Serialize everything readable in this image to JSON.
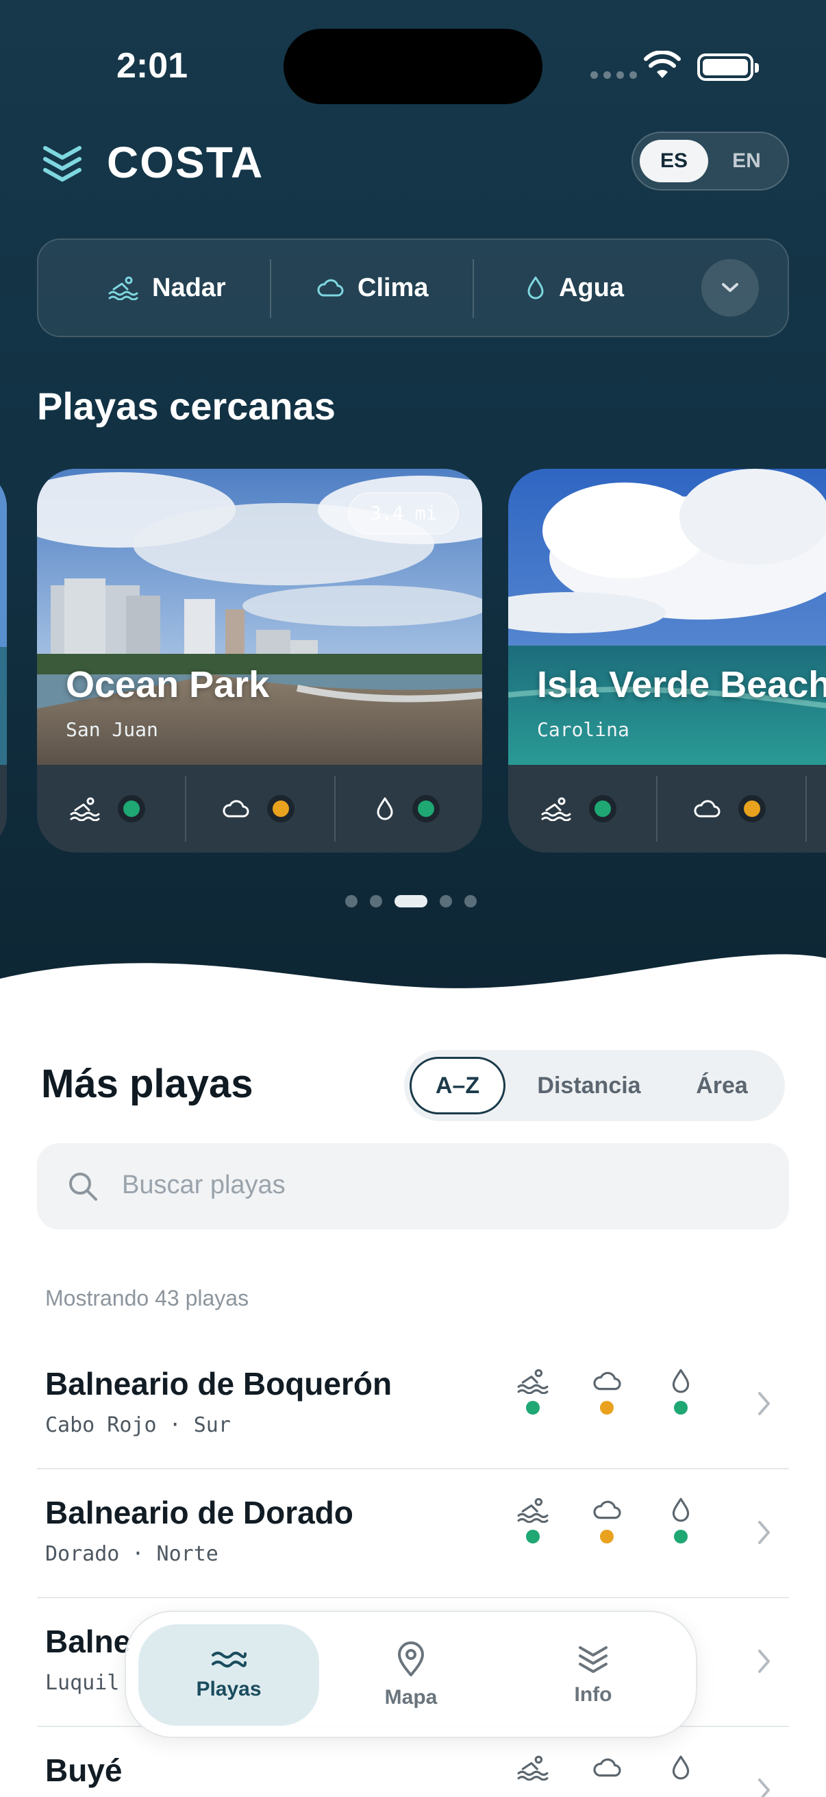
{
  "status_bar": {
    "time": "2:01"
  },
  "header": {
    "brand": "COSTA",
    "lang_es": "ES",
    "lang_en": "EN"
  },
  "filters": [
    {
      "label": "Nadar",
      "icon": "swim-icon"
    },
    {
      "label": "Clima",
      "icon": "cloud-icon"
    },
    {
      "label": "Agua",
      "icon": "water-drop-icon"
    }
  ],
  "nearby": {
    "title": "Playas cercanas",
    "cards": [
      {
        "name": "Ocean Park",
        "area": "San Juan",
        "distance": "3.4 mi",
        "swim": "green",
        "weather": "amber",
        "water": "green"
      },
      {
        "name": "Isla Verde Beach",
        "area": "Carolina",
        "swim": "green",
        "weather": "amber"
      }
    ],
    "pages": 5,
    "active_page": 3
  },
  "more": {
    "title": "Más playas",
    "sort": [
      "A–Z",
      "Distancia",
      "Área"
    ],
    "sort_active": "A–Z",
    "search_placeholder": "Buscar playas",
    "showing": "Mostrando 43 playas",
    "beaches": [
      {
        "name": "Balneario de Boquerón",
        "area": "Cabo Rojo · Sur",
        "swim": "green",
        "weather": "amber",
        "water": "green"
      },
      {
        "name": "Balneario de Dorado",
        "area": "Dorado · Norte",
        "swim": "green",
        "weather": "amber",
        "water": "green"
      },
      {
        "name": "Balne",
        "area": "Luquil"
      },
      {
        "name": "Buyé",
        "area": ""
      }
    ]
  },
  "nav": [
    {
      "label": "Playas",
      "icon": "waves-icon",
      "active": true
    },
    {
      "label": "Mapa",
      "icon": "map-pin-icon"
    },
    {
      "label": "Info",
      "icon": "layers-icon"
    }
  ],
  "colors": {
    "green": "#1fa774",
    "amber": "#e8a21e",
    "accent": "#7fd7e0",
    "hero": "#15374a"
  }
}
